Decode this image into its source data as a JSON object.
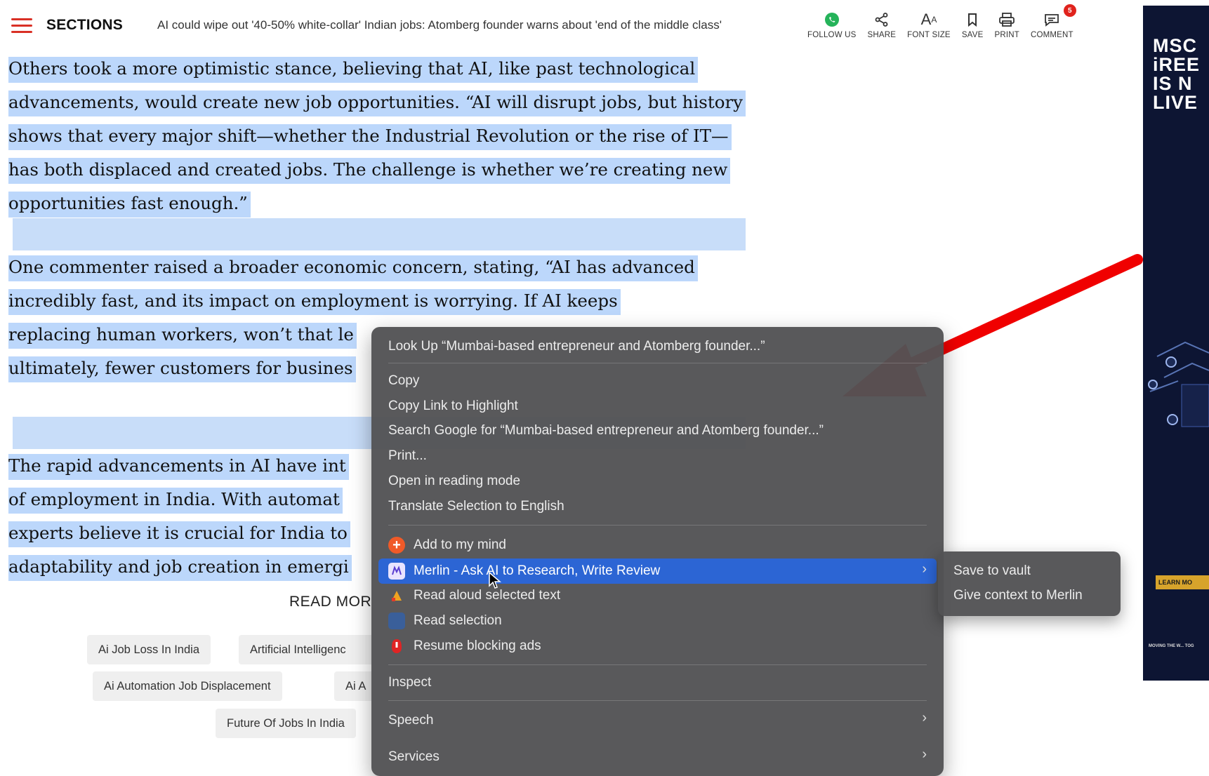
{
  "header": {
    "sections_label": "SECTIONS",
    "headline": "AI could wipe out '40-50% white-collar' Indian jobs: Atomberg founder warns about 'end of the middle class'",
    "tools": [
      {
        "label": "FOLLOW US",
        "icon": "whatsapp-icon"
      },
      {
        "label": "SHARE",
        "icon": "share-icon"
      },
      {
        "label": "FONT SIZE",
        "icon": "font-size-icon"
      },
      {
        "label": "SAVE",
        "icon": "bookmark-icon"
      },
      {
        "label": "PRINT",
        "icon": "print-icon"
      },
      {
        "label": "COMMENT",
        "icon": "comment-icon",
        "badge": "5"
      }
    ]
  },
  "article": {
    "p1": "Others took a more optimistic stance, believing that AI, like past technological advancements, would create new job opportunities. “AI will disrupt jobs, but history shows that every major shift—whether the Industrial Revolution or the rise of IT—has both displaced and created jobs. The challenge is whether we’re creating new opportunities fast enough.”",
    "p2_lines": [
      "One commenter raised a broader economic concern, stating, “AI has advanced",
      "incredibly fast, and its impact on employment is worrying. If AI keeps",
      "replacing human workers, won’t that le",
      "ultimately, fewer customers for busines"
    ],
    "p3_lines": [
      "The rapid advancements in AI have int",
      "of employment in India. With automat",
      "experts believe it is crucial for India to",
      "adaptability and job creation in emergi"
    ]
  },
  "read_more": "READ MOR",
  "tags": [
    "Ai Job Loss In India",
    "Artificial Intelligenc",
    "Ai Automation Job Displacement",
    "Ai A",
    "Future Of Jobs In India"
  ],
  "ad": {
    "headline_lines": [
      "MSC",
      "iREE",
      "IS N",
      "LIVE"
    ],
    "button": "LEARN MO",
    "footer": "MOVING THE W... TOG"
  },
  "context_menu": {
    "items": [
      {
        "label": "Look Up “Mumbai-based entrepreneur and Atomberg founder...”"
      },
      {
        "label": "Copy"
      },
      {
        "label": "Copy Link to Highlight"
      },
      {
        "label": "Search Google for “Mumbai-based entrepreneur and Atomberg founder...”"
      },
      {
        "label": "Print..."
      },
      {
        "label": "Open in reading mode"
      },
      {
        "label": "Translate Selection to English"
      },
      {
        "label": "Add to my mind",
        "icon": "add-icon"
      },
      {
        "label": "Merlin - Ask AI to Research, Write  Review",
        "icon": "merlin-icon"
      },
      {
        "label": "Read aloud selected text",
        "icon": "read-aloud-icon"
      },
      {
        "label": "Read selection",
        "icon": "read-selection-icon"
      },
      {
        "label": "Resume blocking ads",
        "icon": "adblock-icon"
      },
      {
        "label": "Inspect"
      },
      {
        "label": "Speech"
      },
      {
        "label": "Services"
      }
    ],
    "submenu": [
      {
        "label": "Save to vault"
      },
      {
        "label": "Give context to Merlin"
      }
    ]
  },
  "colors": {
    "accent": "#d93025",
    "selection": "#bcd7fb",
    "menu_bg": "#525254",
    "menu_highlight": "#2c65d4",
    "arrow": "#f00000"
  }
}
